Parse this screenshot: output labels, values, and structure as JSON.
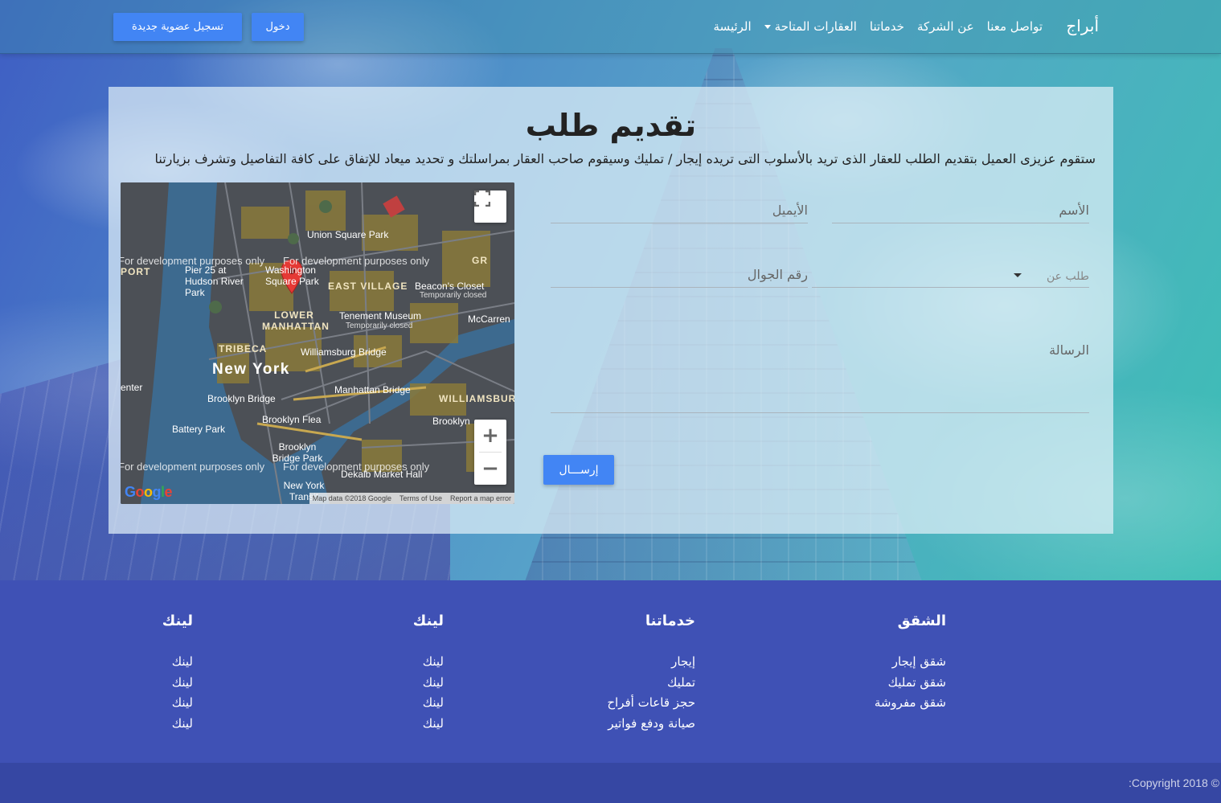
{
  "nav": {
    "brand": "أبراج",
    "links": [
      "الرئيسة",
      "العقارات المتاحة",
      "خدماتنا",
      "عن الشركة",
      "تواصل معنا"
    ],
    "login": "دخول",
    "register": "تسجيل عضوية جديدة"
  },
  "form": {
    "title": "تقديم طلب",
    "description": "ستقوم عزيزى العميل بتقديم الطلب للعقار الذى تريد بالأسلوب التى تريده إيجار / تمليك وسيقوم صاحب العقار بمراسلتك و تحديد ميعاد للإتفاق على كافة التفاصيل وتشرف بزيارتنا",
    "name_placeholder": "الأسم",
    "email_placeholder": "الأيميل",
    "request_type_placeholder": "طلب عن",
    "phone_placeholder": "رقم الجوال",
    "message_placeholder": "الرسالة",
    "submit": "إرســـال"
  },
  "map": {
    "labels": {
      "union_square": "Union Square Park",
      "pier25": "Pier 25 at Hudson River Park",
      "wash_sq": "Washington Square Park",
      "east_village": "EAST VILLAGE",
      "beacons": "Beacon's Closet",
      "beacons_sub": "Temporarily closed",
      "lower_manhattan": "LOWER MANHATTAN",
      "tenement": "Tenement Museum",
      "tenement_sub": "Temporarily closed",
      "mccarren": "McCarren",
      "tribeca": "TRIBECA",
      "williamsburg_bridge": "Williamsburg Bridge",
      "new_york": "New York",
      "manhattan_bridge": "Manhattan Bridge",
      "brooklyn_bridge": "Brooklyn Bridge",
      "williamsburg": "WILLIAMSBURG",
      "battery": "Battery Park",
      "flea": "Brooklyn Flea",
      "brooklyn": "Brooklyn",
      "bb_park": "Brooklyn Bridge Park",
      "dekalb": "Dekalb Market Hall",
      "ny_transit": "New York Transit",
      "center": "enter",
      "port": "PORT",
      "gr": "GR",
      "dev_notice": "For development purposes only"
    },
    "footer": [
      "Map data ©2018 Google",
      "Terms of Use",
      "Report a map error"
    ],
    "logo": "Google"
  },
  "footer": {
    "columns": [
      {
        "title": "الشقق",
        "items": [
          "شقق إيجار",
          "شقق تمليك",
          "شقق مفروشة"
        ]
      },
      {
        "title": "خدماتنا",
        "items": [
          "إيجار",
          "تمليك",
          "حجز قاعات أفراح",
          "صيانة ودفع فواتير"
        ]
      },
      {
        "title": "لينك",
        "items": [
          "لينك",
          "لينك",
          "لينك",
          "لينك"
        ]
      },
      {
        "title": "لينك",
        "items": [
          "لينك",
          "لينك",
          "لينك",
          "لينك"
        ]
      }
    ],
    "copyright": "© Copyright 2018:"
  }
}
